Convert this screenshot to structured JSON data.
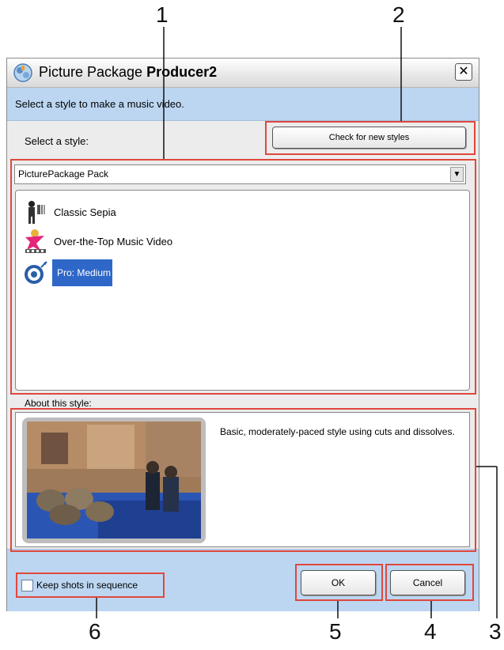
{
  "window": {
    "title_regular": "Picture Package ",
    "title_bold": "Producer2",
    "close_glyph": "✕",
    "instruction": "Select a style to make a music video."
  },
  "style_section": {
    "label": "Select a style:",
    "check_button": "Check for new styles",
    "pack_selected": "PicturePackage Pack",
    "items": [
      {
        "label": "Classic Sepia",
        "icon": "classic-sepia-icon"
      },
      {
        "label": "Over-the-Top Music Video",
        "icon": "music-video-icon"
      },
      {
        "label": "Pro: Medium",
        "icon": "pro-medium-icon",
        "selected": true
      }
    ]
  },
  "about_section": {
    "label": "About this style:",
    "description": "Basic, moderately-paced style using cuts and dissolves."
  },
  "footer": {
    "keep_shots_label": "Keep shots in sequence",
    "keep_shots_checked": false,
    "ok_label": "OK",
    "cancel_label": "Cancel"
  },
  "callouts": [
    "1",
    "2",
    "3",
    "4",
    "5",
    "6"
  ],
  "colors": {
    "highlight": "#e0473d",
    "panel_blue": "#bcd6f2",
    "selection": "#2f67c8"
  }
}
